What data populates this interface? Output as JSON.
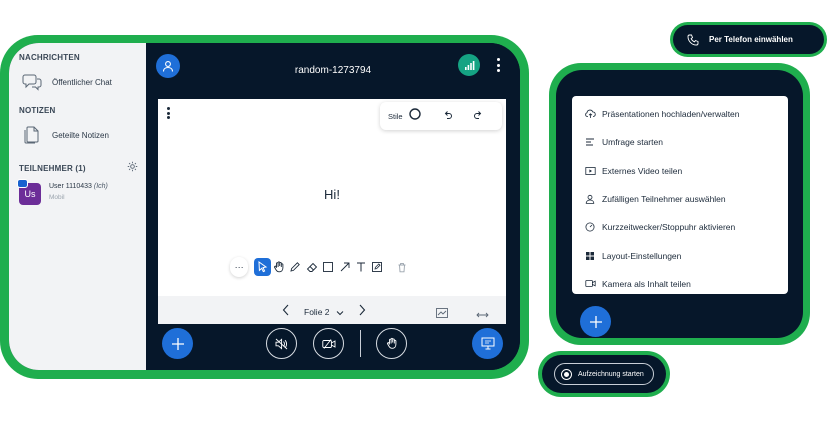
{
  "sidebar": {
    "messages_heading": "NACHRICHTEN",
    "public_chat_label": "Öffentlicher Chat",
    "notes_heading": "NOTIZEN",
    "shared_notes_label": "Geteilte Notizen",
    "participants_heading": "TEILNEHMER (1)",
    "user": {
      "avatar_initials": "Us",
      "name": "User 1110433",
      "you_label": "(Ich)",
      "status": "Mobil"
    }
  },
  "header": {
    "room_title": "random-1273794"
  },
  "whiteboard": {
    "style_label": "Stile",
    "more_label": "···",
    "canvas_text": "Hi!",
    "slide_label": "Folie 2"
  },
  "phone": {
    "label": "Per Telefon einwählen"
  },
  "actions_menu": {
    "items": [
      {
        "label": "Präsentationen hochladen/verwalten",
        "icon": "upload-icon"
      },
      {
        "label": "Umfrage starten",
        "icon": "poll-icon"
      },
      {
        "label": "Externes Video teilen",
        "icon": "video-icon"
      },
      {
        "label": "Zufälligen Teilnehmer auswählen",
        "icon": "user-icon"
      },
      {
        "label": "Kurzzeitwecker/Stoppuhr aktivieren",
        "icon": "timer-icon"
      },
      {
        "label": "Layout-Einstellungen",
        "icon": "layout-icon"
      },
      {
        "label": "Kamera als Inhalt teilen",
        "icon": "camera-icon"
      }
    ]
  },
  "recording": {
    "label": "Aufzeichnung starten"
  },
  "colors": {
    "frame_green": "#1fae4e",
    "dark_bg": "#06172a",
    "accent_blue": "#1f6fd8",
    "signal_teal": "#15a383",
    "avatar_purple": "#6c2d98"
  }
}
